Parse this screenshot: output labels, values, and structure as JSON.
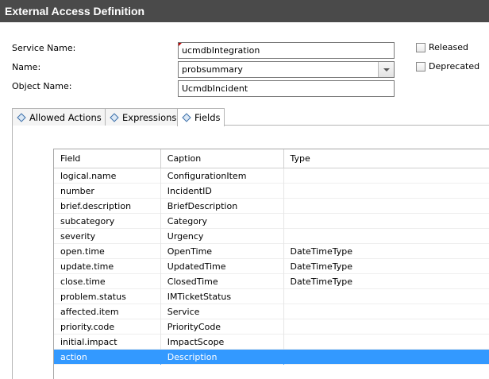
{
  "window": {
    "title": "External Access Definition"
  },
  "form": {
    "service_name_label": "Service Name:",
    "service_name_value": "ucmdbIntegration",
    "name_label": "Name:",
    "name_value": "probsummary",
    "object_name_label": "Object Name:",
    "object_name_value": "UcmdbIncident",
    "released_label": "Released",
    "deprecated_label": "Deprecated"
  },
  "tabs": [
    {
      "label": "Allowed Actions",
      "icon": "diamond-icon"
    },
    {
      "label": "Expressions",
      "icon": "diamond-icon"
    },
    {
      "label": "Fields",
      "icon": "diamond-icon",
      "active": true
    }
  ],
  "table": {
    "columns": [
      "Field",
      "Caption",
      "Type"
    ],
    "rows": [
      {
        "field": "logical.name",
        "caption": "ConfigurationItem",
        "type": ""
      },
      {
        "field": "number",
        "caption": "IncidentID",
        "type": ""
      },
      {
        "field": "brief.description",
        "caption": "BriefDescription",
        "type": ""
      },
      {
        "field": "subcategory",
        "caption": "Category",
        "type": ""
      },
      {
        "field": "severity",
        "caption": "Urgency",
        "type": ""
      },
      {
        "field": "open.time",
        "caption": "OpenTime",
        "type": "DateTimeType"
      },
      {
        "field": "update.time",
        "caption": "UpdatedTime",
        "type": "DateTimeType"
      },
      {
        "field": "close.time",
        "caption": "ClosedTime",
        "type": "DateTimeType"
      },
      {
        "field": "problem.status",
        "caption": "IMTicketStatus",
        "type": ""
      },
      {
        "field": "affected.item",
        "caption": "Service",
        "type": ""
      },
      {
        "field": "priority.code",
        "caption": "PriorityCode",
        "type": ""
      },
      {
        "field": "initial.impact",
        "caption": "ImpactScope",
        "type": ""
      },
      {
        "field": "action",
        "caption": "Description",
        "type": "",
        "selected": true
      }
    ]
  },
  "colors": {
    "titlebar": "#4a4a4a",
    "selection": "#3399ff"
  }
}
